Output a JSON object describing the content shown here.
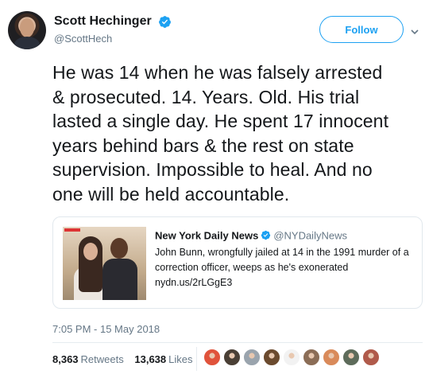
{
  "tweet": {
    "author": {
      "display_name": "Scott Hechinger",
      "handle": "@ScottHech",
      "verified": true,
      "avatar_icon": "profile-photo"
    },
    "follow_label": "Follow",
    "text": "He was 14 when he was falsely arrested\n& prosecuted. 14. Years. Old. His trial\nlasted a single day. He spent 17 innocent\nyears behind bars & the rest on state\nsupervision. Impossible to heal. And no\none will be held accountable.",
    "quoted": {
      "display_name": "New York Daily News",
      "handle": "@NYDailyNews",
      "verified": true,
      "text": "John Bunn, wrongfully jailed at 14 in the 1991 murder of a correction officer, weeps as he's exonerated nydn.us/2rLGgE3"
    },
    "timestamp": "7:05 PM - 15 May 2018",
    "stats": {
      "retweets_count": "8,363",
      "retweets_label": "Retweets",
      "likes_count": "13,638",
      "likes_label": "Likes"
    },
    "likers": [
      {
        "name": "liker-avatar-1",
        "color": "#e0533b"
      },
      {
        "name": "liker-avatar-2",
        "color": "#4a3f35"
      },
      {
        "name": "liker-avatar-3",
        "color": "#9aa4ad"
      },
      {
        "name": "liker-avatar-4",
        "color": "#6b4a2e"
      },
      {
        "name": "liker-avatar-5",
        "color": "#f2f2f2"
      },
      {
        "name": "liker-avatar-6",
        "color": "#8b6d56"
      },
      {
        "name": "liker-avatar-7",
        "color": "#d98a5a"
      },
      {
        "name": "liker-avatar-8",
        "color": "#5d6b5a"
      },
      {
        "name": "liker-avatar-9",
        "color": "#b05a4a"
      }
    ]
  },
  "colors": {
    "accent": "#1da1f2",
    "secondary_text": "#657786",
    "primary_text": "#14171a",
    "border": "#e1e8ed"
  }
}
